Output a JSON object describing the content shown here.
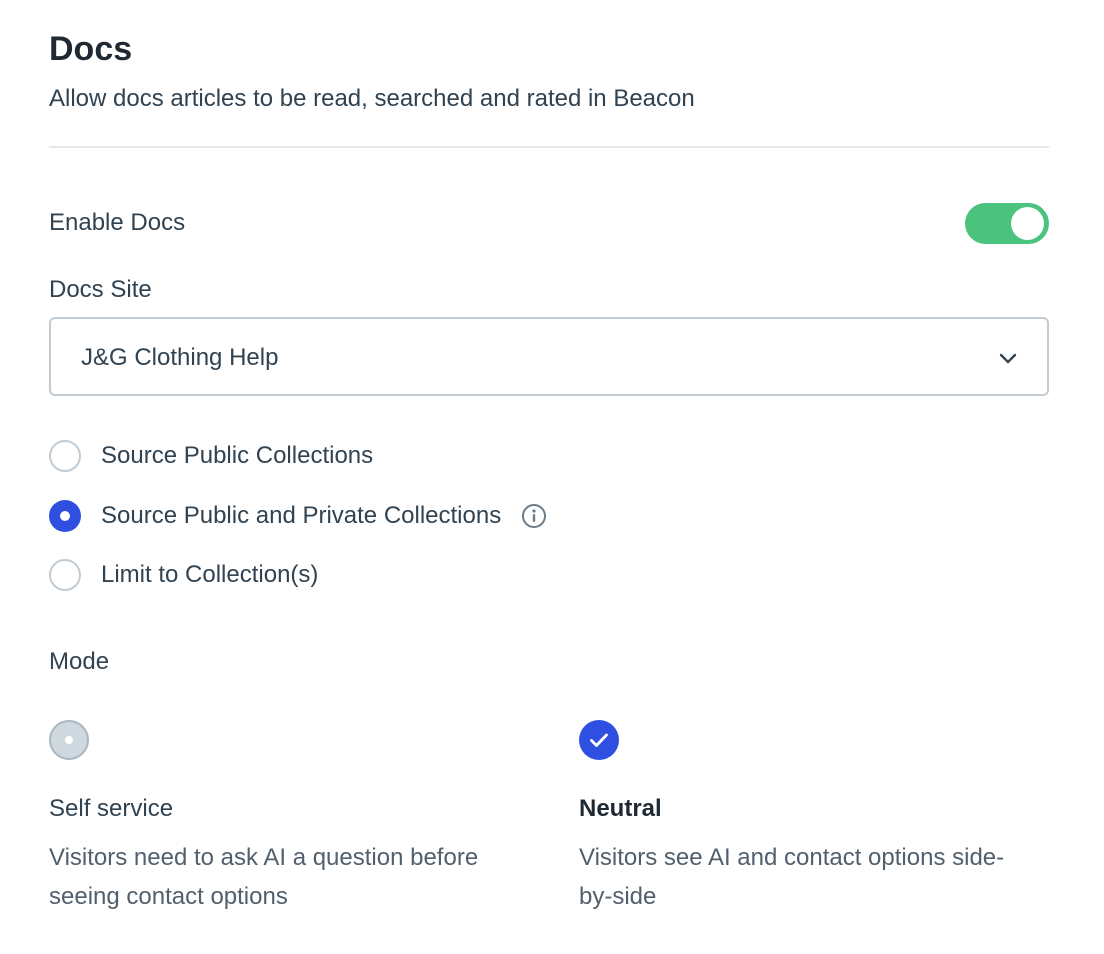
{
  "header": {
    "title": "Docs",
    "subtitle": "Allow docs articles to be read, searched and rated in Beacon"
  },
  "enable_docs": {
    "label": "Enable Docs",
    "enabled": true
  },
  "docs_site": {
    "label": "Docs Site",
    "selected": "J&G Clothing Help"
  },
  "source_options": [
    {
      "label": "Source Public Collections",
      "checked": false
    },
    {
      "label": "Source Public and Private Collections",
      "checked": true,
      "icon": "info-icon"
    },
    {
      "label": "Limit to Collection(s)",
      "checked": false
    }
  ],
  "mode": {
    "label": "Mode",
    "options": [
      {
        "name": "Self service",
        "description": "Visitors need to ask AI a question before seeing contact options",
        "selected": false
      },
      {
        "name": "Neutral",
        "description": "Visitors see AI and contact options side-by-side",
        "selected": true
      }
    ]
  },
  "colors": {
    "accent": "#2f4fe0",
    "toggle_on": "#4bc27d",
    "text": "#314351"
  }
}
